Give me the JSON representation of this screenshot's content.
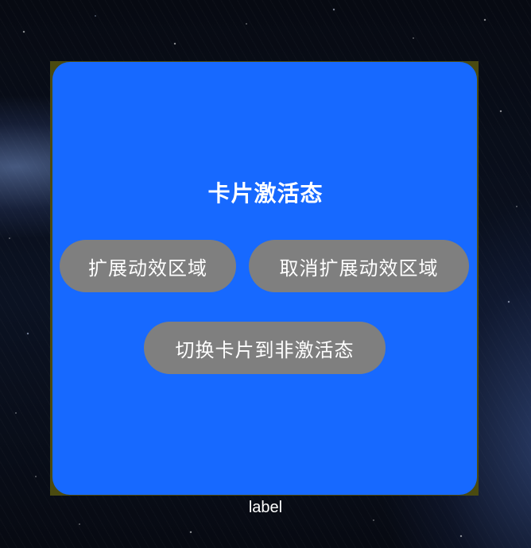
{
  "card": {
    "title": "卡片激活态",
    "background_color": "#1769ff",
    "buttons": {
      "expand_label": "扩展动效区域",
      "cancel_expand_label": "取消扩展动效区域",
      "switch_label": "切换卡片到非激活态"
    },
    "button_color": "#7f7f7f"
  },
  "footer": {
    "label": "label"
  }
}
